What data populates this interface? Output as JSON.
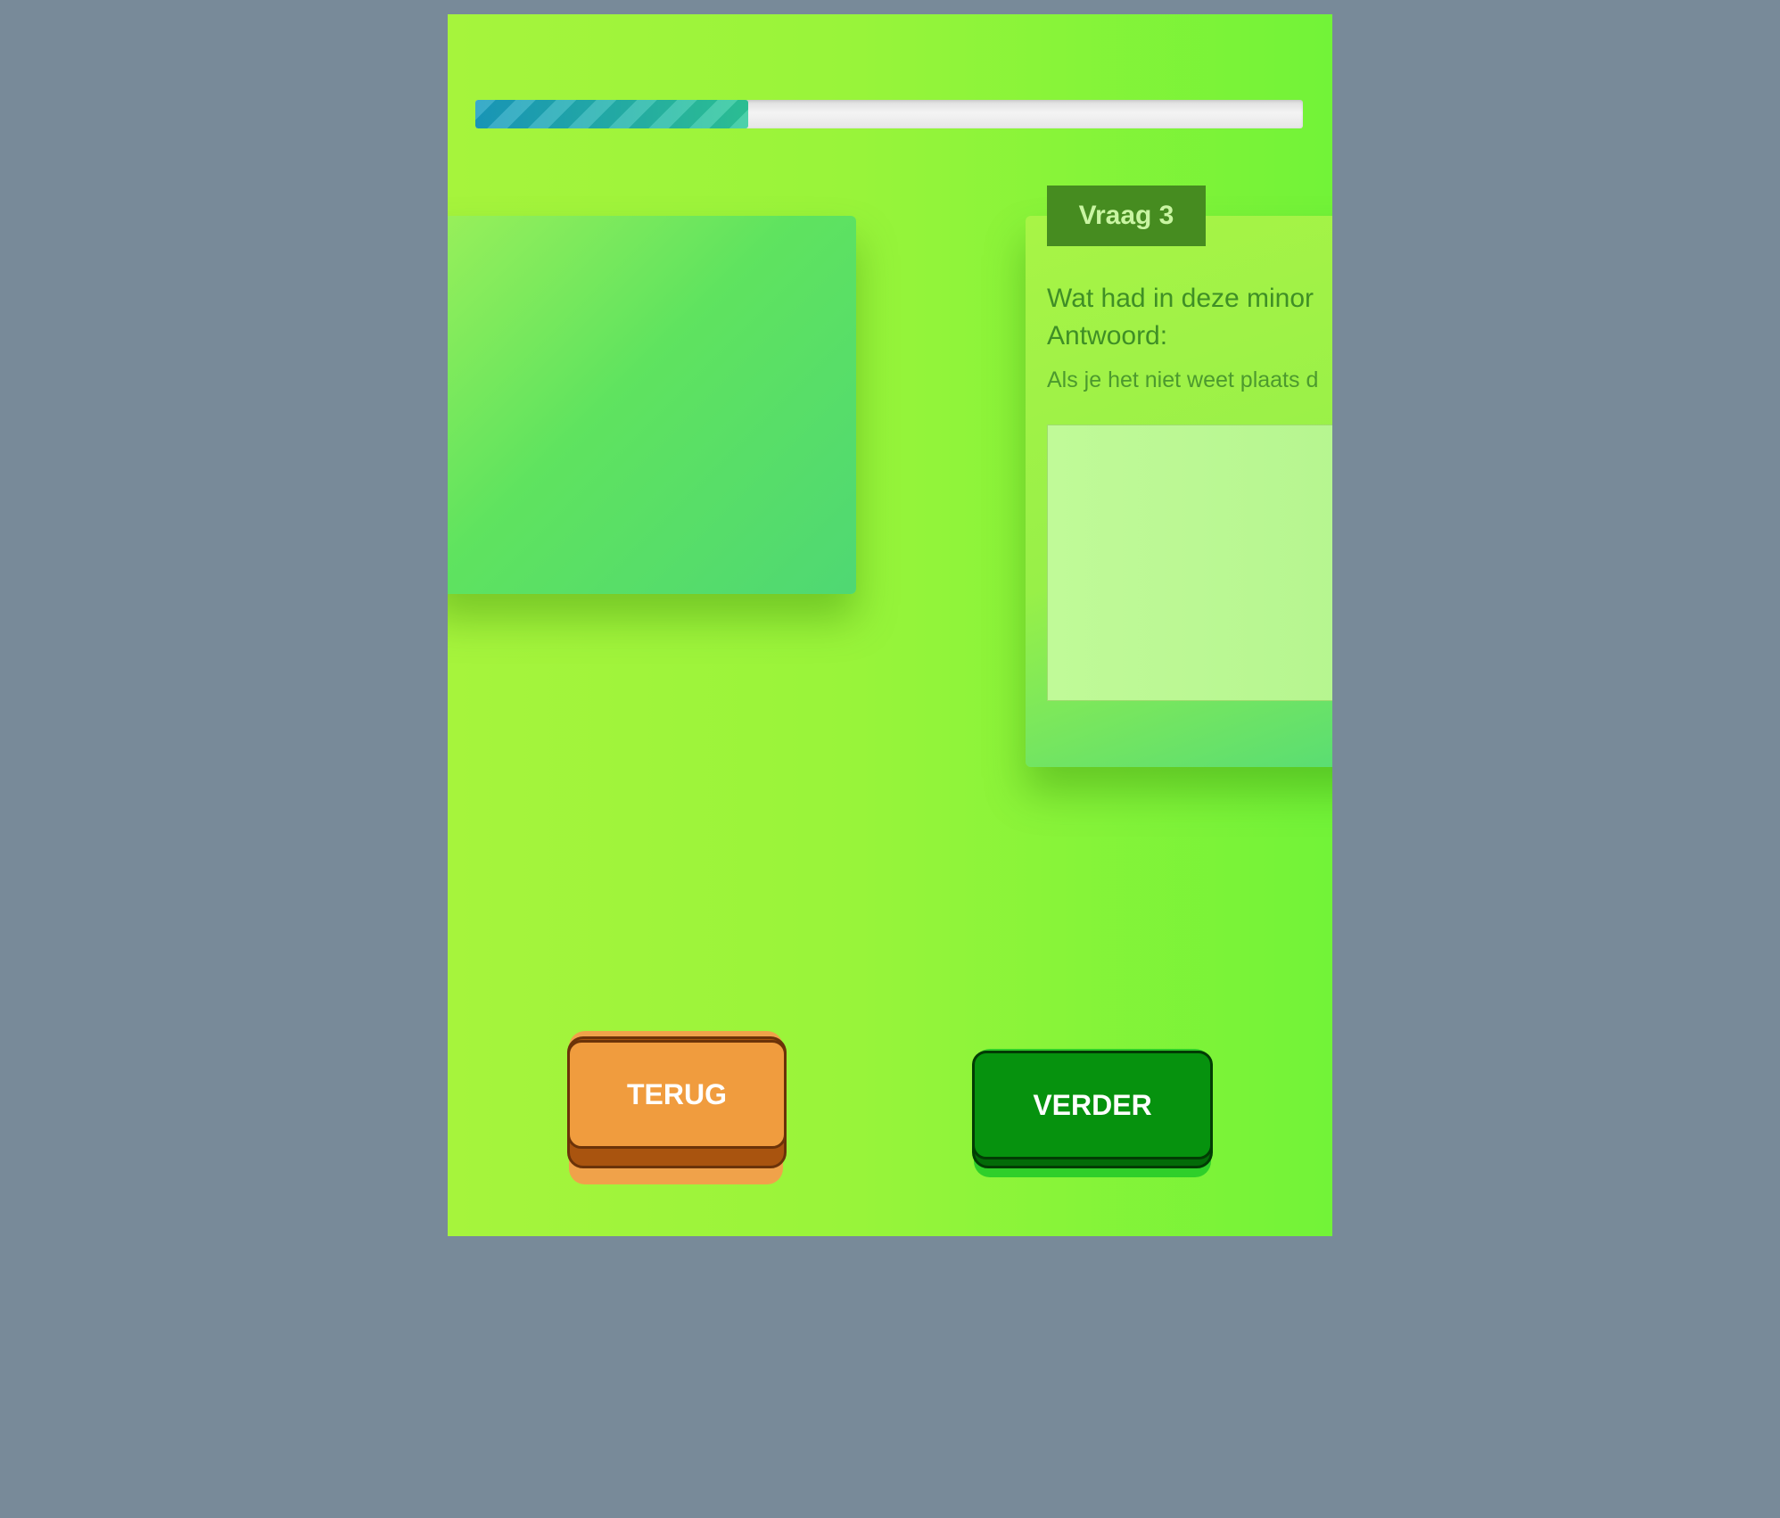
{
  "progress": {
    "value_percent": 33,
    "fill_colors": [
      "#1a9dc1",
      "#2ec99b"
    ]
  },
  "question": {
    "tag": "Vraag 3",
    "text_line1": "Wat had in deze minor",
    "text_line2": "Antwoord:",
    "hint": "Als je het niet weet plaats d",
    "answer_value": ""
  },
  "buttons": {
    "back_label": "TERUG",
    "next_label": "VERDER"
  },
  "colors": {
    "background": "#788a99",
    "back_button": "#f09c3e",
    "next_button": "#06920e",
    "tag": "#468c20"
  }
}
